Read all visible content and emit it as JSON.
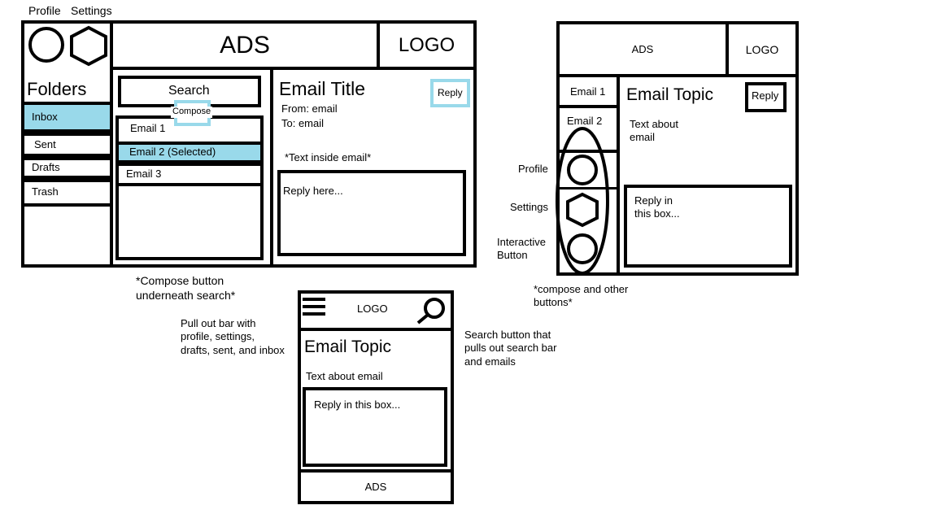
{
  "desktop": {
    "top_labels": {
      "profile": "Profile",
      "settings": "Settings"
    },
    "ads": "ADS",
    "logo": "LOGO",
    "folders_title": "Folders",
    "folders": [
      "Inbox",
      "Sent",
      "Drafts",
      "Trash"
    ],
    "search_label": "Search",
    "compose_label": "Compose",
    "emails": [
      "Email 1",
      "Email 2  (Selected)",
      "Email 3"
    ],
    "email_title": "Email Title",
    "reply_label": "Reply",
    "from": "From: email",
    "to": "To: email",
    "body": "*Text inside email*",
    "reply_placeholder": "Reply here...",
    "note": "*Compose button\nunderneath search*"
  },
  "tablet": {
    "ads": "ADS",
    "logo": "LOGO",
    "emails": [
      "Email 1",
      "Email 2"
    ],
    "email_topic": "Email Topic",
    "reply_label": "Reply",
    "body": "Text about\nemail",
    "reply_placeholder": "Reply in\nthis box...",
    "side_labels": {
      "profile": "Profile",
      "settings": "Settings",
      "interactive": "Interactive\nButton"
    },
    "note": "*compose and other\nbuttons*"
  },
  "mobile": {
    "logo": "LOGO",
    "email_topic": "Email Topic",
    "body": "Text about email",
    "reply_placeholder": "Reply in this box...",
    "ads": "ADS",
    "left_note": "Pull out bar with\nprofile, settings,\ndrafts, sent, and inbox",
    "right_note": "Search button that\npulls out search bar\nand emails"
  }
}
